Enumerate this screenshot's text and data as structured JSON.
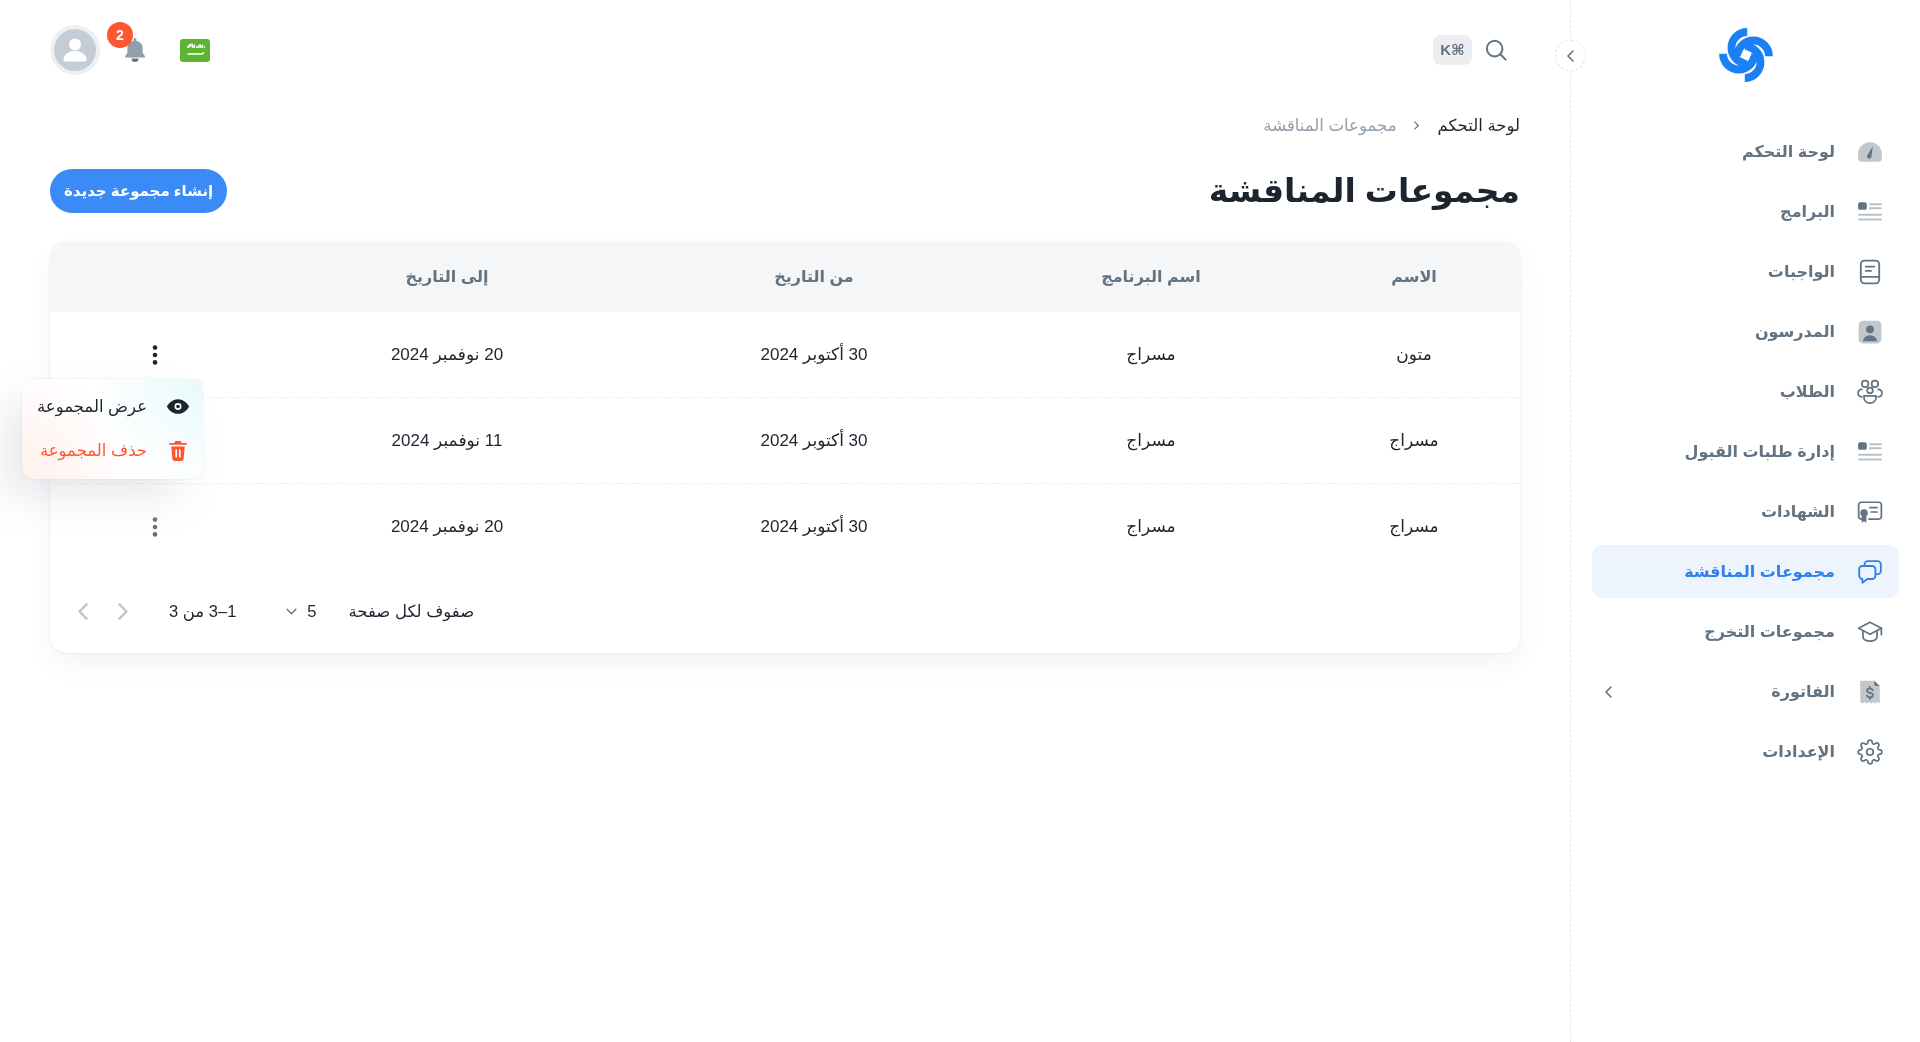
{
  "sidebar": {
    "items": [
      {
        "label": "لوحة التحكم",
        "kind": "link",
        "selected": false
      },
      {
        "label": "البرامج",
        "kind": "link",
        "selected": false
      },
      {
        "label": "الواجبات",
        "kind": "link",
        "selected": false
      },
      {
        "label": "المدرسون",
        "kind": "link",
        "selected": false
      },
      {
        "label": "الطلاب",
        "kind": "link",
        "selected": false
      },
      {
        "label": "إدارة طلبات القبول",
        "kind": "link",
        "selected": false
      },
      {
        "label": "الشهادات",
        "kind": "link",
        "selected": false
      },
      {
        "label": "مجموعات المناقشة",
        "kind": "link",
        "selected": true
      },
      {
        "label": "مجموعات التخرج",
        "kind": "link",
        "selected": false
      },
      {
        "label": "الفاتورة",
        "kind": "group",
        "selected": false,
        "expanded": false
      },
      {
        "label": "الإعدادات",
        "kind": "link",
        "selected": false
      }
    ]
  },
  "header": {
    "shortcut": "⌘K",
    "notification_count": "2"
  },
  "breadcrumb": [
    {
      "label": "لوحة التحكم",
      "current": false
    },
    {
      "label": "مجموعات المناقشة",
      "current": true
    }
  ],
  "page_title": "مجموعات المناقشة",
  "create_button": "إنشاء مجموعة جديدة",
  "table": {
    "columns": [
      "الاسم",
      "اسم البرنامج",
      "من التاريخ",
      "إلى التاريخ"
    ],
    "rows": [
      {
        "cells": [
          "متون",
          "مسراج",
          "30 أكتوبر 2024",
          "20 نوفمبر 2024"
        ],
        "menu_open": true
      },
      {
        "cells": [
          "مسراج",
          "مسراج",
          "30 أكتوبر 2024",
          "11 نوفمبر 2024"
        ],
        "menu_open": false
      },
      {
        "cells": [
          "مسراج",
          "مسراج",
          "30 أكتوبر 2024",
          "20 نوفمبر 2024"
        ],
        "menu_open": false
      }
    ],
    "row_menu": [
      {
        "label": "عرض المجموعة",
        "kind": "view"
      },
      {
        "label": "حذف المجموعة",
        "kind": "delete"
      }
    ],
    "pagination": {
      "rows_per_page_label": "صفوف لكل صفحة",
      "rows_per_page": "5",
      "range": "1–3 من 3",
      "previous_disabled": true,
      "next_disabled": true
    }
  }
}
